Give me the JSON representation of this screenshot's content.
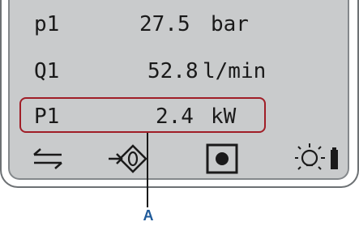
{
  "readings": [
    {
      "name": "p1",
      "value": "27.5",
      "unit": "bar"
    },
    {
      "name": "Q1",
      "value": "52.8",
      "unit": "l/min"
    },
    {
      "name": "P1",
      "value": "2.4",
      "unit": "kW"
    }
  ],
  "callout": {
    "label": "A"
  },
  "icons": {
    "left": "exchange-arrows-icon",
    "second": "zero-input-icon",
    "third": "record-stop-icon",
    "light": "light-bulb-icon",
    "battery": "battery-icon"
  },
  "colors": {
    "screen": "#c9cbcc",
    "highlight": "#a01e27",
    "callout_label": "#1f5a9a"
  }
}
